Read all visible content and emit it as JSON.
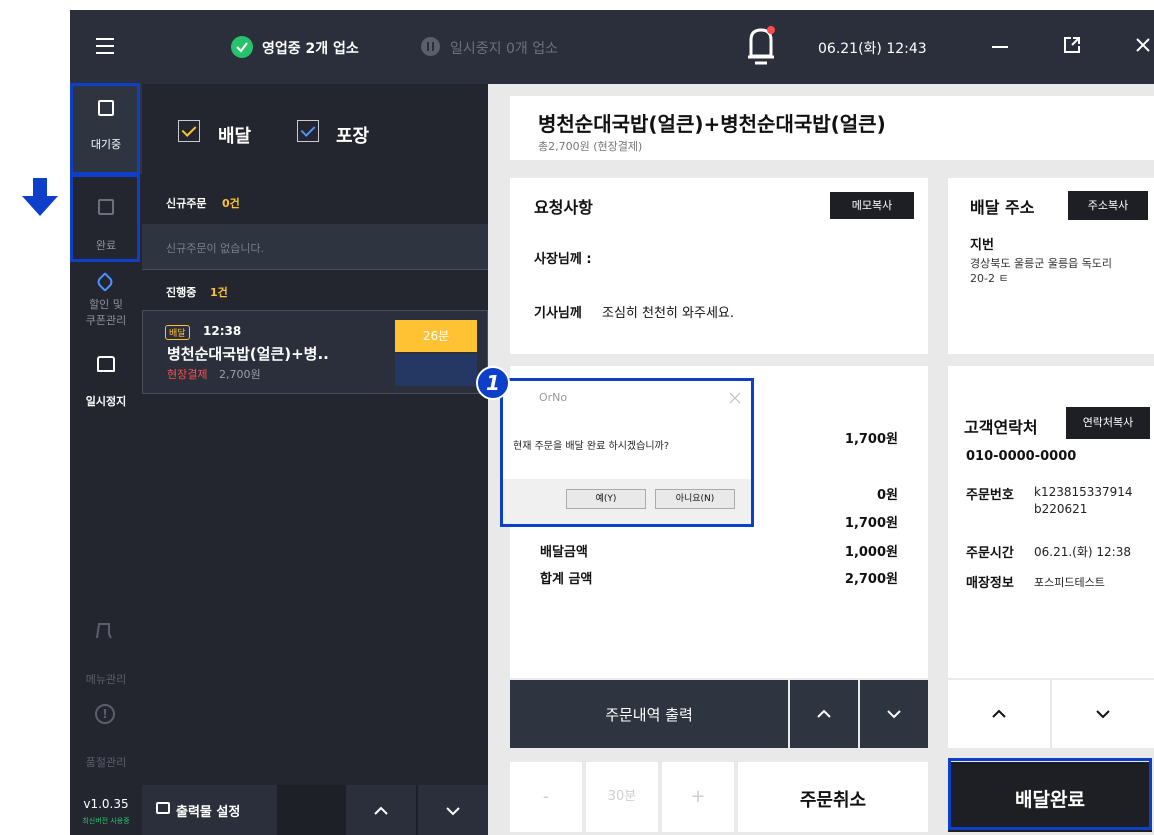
{
  "topbar": {
    "open_status": "영업중 2개 업소",
    "paused_status": "일시중지 0개 업소",
    "datetime": "06.21(화) 12:43"
  },
  "sidebar": {
    "items": [
      {
        "label": "대기중"
      },
      {
        "label": "완료"
      },
      {
        "label": "할인 및\n쿠폰관리"
      },
      {
        "label": "일시정지"
      },
      {
        "label": "메뉴관리"
      },
      {
        "label": "품절관리"
      }
    ],
    "version": "v1.0.35",
    "version_note": "최신버전 사용중"
  },
  "filters": {
    "delivery": "배달",
    "pickup": "포장"
  },
  "new_orders": {
    "title": "신규주문",
    "count": "0건",
    "empty_text": "신규주문이 없습니다."
  },
  "in_progress": {
    "title": "진행중",
    "count": "1건",
    "order": {
      "type_badge": "배달",
      "time": "12:38",
      "name": "병천순대국밥(얼큰)+병..",
      "payment_type": "현장결제",
      "amount": "2,700원",
      "eta": "26분"
    }
  },
  "list_footer": {
    "print_settings": "출력물 설정"
  },
  "order": {
    "title": "병천순대국밥(얼큰)+병천순대국밥(얼큰)",
    "subtitle": "총2,700원 (현장결제)"
  },
  "request": {
    "heading": "요청사항",
    "copy_button": "메모복사",
    "owner_label": "사장님께 :",
    "rider_label": "기사님께",
    "rider_text": "조심히 천천히 와주세요."
  },
  "amounts": {
    "rows": [
      {
        "label": "",
        "value": "1,700원"
      },
      {
        "label": "",
        "value": "0원"
      },
      {
        "label": "",
        "value": "1,700원"
      },
      {
        "label": "배달금액",
        "value": "1,000원"
      },
      {
        "label": "합계 금액",
        "value": "2,700원"
      }
    ]
  },
  "address": {
    "heading": "배달 주소",
    "copy_button": "주소복사",
    "type_label": "지번",
    "text": "경상북도 울릉군 울릉읍 독도리\n20-2 ㅌ"
  },
  "customer": {
    "heading": "고객연락처",
    "copy_button": "연락처복사",
    "phone": "010-0000-0000",
    "order_no_label": "주문번호",
    "order_no": "k123815337914\nb220621",
    "order_time_label": "주문시간",
    "order_time": "06.21.(화) 12:38",
    "store_label": "매장정보",
    "store": "포스피드테스트"
  },
  "actions": {
    "print_order": "주문내역 출력",
    "minus": "-",
    "time_value": "30분",
    "plus": "+",
    "cancel": "주문취소",
    "complete": "배달완료"
  },
  "dialog": {
    "title": "OrNo",
    "message": "현재 주문을 배달 완료 하시겠습니까?",
    "yes": "예(Y)",
    "no": "아니요(N)",
    "step_badge": "1"
  },
  "colors": {
    "dark_bg": "#23262f",
    "topbar_bg": "#2b2f3b",
    "accent_yellow": "#ffc233",
    "highlight_blue": "#0d3fc8",
    "panel_bg": "#ffffff",
    "payment_red": "#ff4b4b",
    "open_green": "#27c26c"
  }
}
